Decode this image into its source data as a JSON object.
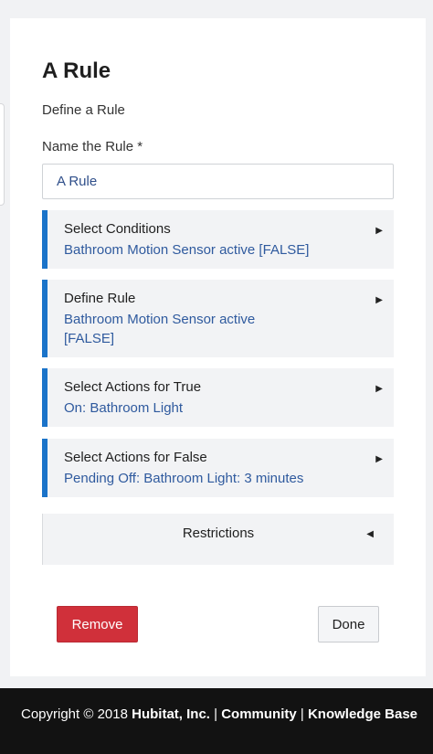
{
  "page": {
    "title": "A Rule",
    "subtitle": "Define a Rule"
  },
  "name_field": {
    "label": "Name the Rule *",
    "value": "A Rule"
  },
  "sections": [
    {
      "title": "Select Conditions",
      "value": "Bathroom Motion Sensor active [FALSE]"
    },
    {
      "title": "Define Rule",
      "value": "Bathroom Motion Sensor active [FALSE]"
    },
    {
      "title": "Select Actions for True",
      "value": "On: Bathroom Light"
    },
    {
      "title": "Select Actions for False",
      "value": "Pending Off: Bathroom Light: 3 minutes"
    }
  ],
  "restrictions": {
    "label": "Restrictions"
  },
  "buttons": {
    "remove": "Remove",
    "done": "Done"
  },
  "footer": {
    "copyright": "Copyright © 2018",
    "company": "Hubitat, Inc.",
    "sep1": "|",
    "community": "Community",
    "sep2": "|",
    "knowledge_base": "Knowledge Base"
  },
  "icons": {
    "expand": "play-right-icon",
    "collapse": "play-left-icon"
  },
  "colors": {
    "accent": "#1a73c9",
    "value_text": "#2f5a9e",
    "remove_button": "#d0303a",
    "footer_bg": "#121212"
  }
}
